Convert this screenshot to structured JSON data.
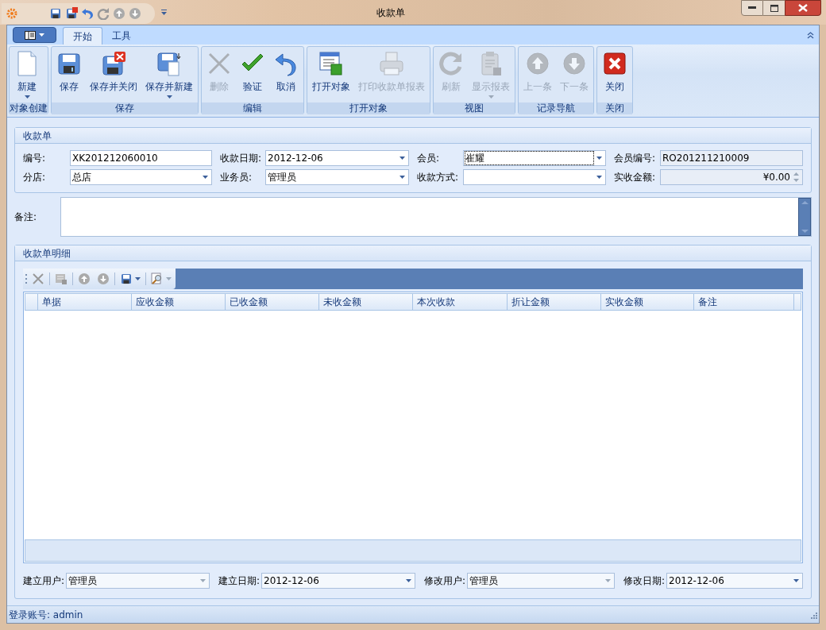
{
  "window": {
    "title": "收款单"
  },
  "ribbon": {
    "tabs": [
      {
        "label": "开始",
        "selected": true
      },
      {
        "label": "工具",
        "selected": false
      }
    ],
    "groups": [
      {
        "label": "对象创建",
        "buttons": [
          {
            "label": "新建",
            "disabled": false,
            "dropdown": true
          }
        ]
      },
      {
        "label": "保存",
        "buttons": [
          {
            "label": "保存",
            "disabled": false,
            "dropdown": false
          },
          {
            "label": "保存并关闭",
            "disabled": false,
            "dropdown": false
          },
          {
            "label": "保存并新建",
            "disabled": false,
            "dropdown": true
          }
        ]
      },
      {
        "label": "编辑",
        "buttons": [
          {
            "label": "删除",
            "disabled": true,
            "dropdown": false
          },
          {
            "label": "验证",
            "disabled": false,
            "dropdown": false
          },
          {
            "label": "取消",
            "disabled": false,
            "dropdown": false
          }
        ]
      },
      {
        "label": "打开对象",
        "buttons": [
          {
            "label": "打开对象",
            "disabled": false,
            "dropdown": false
          },
          {
            "label": "打印收款单报表",
            "disabled": true,
            "dropdown": false
          }
        ]
      },
      {
        "label": "视图",
        "buttons": [
          {
            "label": "刷新",
            "disabled": true,
            "dropdown": false
          },
          {
            "label": "显示报表",
            "disabled": true,
            "dropdown": true
          }
        ]
      },
      {
        "label": "记录导航",
        "buttons": [
          {
            "label": "上一条",
            "disabled": true,
            "dropdown": false
          },
          {
            "label": "下一条",
            "disabled": true,
            "dropdown": false
          }
        ]
      },
      {
        "label": "关闭",
        "buttons": [
          {
            "label": "关闭",
            "disabled": false,
            "dropdown": false
          }
        ]
      }
    ]
  },
  "form": {
    "title": "收款单",
    "fields": [
      {
        "label": "编号:",
        "value": "XK201212060010",
        "kind": "text",
        "readonly": false,
        "focused": false
      },
      {
        "label": "收款日期:",
        "value": "2012-12-06",
        "kind": "combo",
        "readonly": false,
        "focused": false
      },
      {
        "label": "会员:",
        "value": "崔耀",
        "kind": "combo",
        "readonly": false,
        "focused": true
      },
      {
        "label": "会员编号:",
        "value": "RO201211210009",
        "kind": "text",
        "readonly": true,
        "focused": false
      },
      {
        "label": "分店:",
        "value": "总店",
        "kind": "combo",
        "readonly": false,
        "focused": false
      },
      {
        "label": "业务员:",
        "value": "管理员",
        "kind": "combo",
        "readonly": false,
        "focused": false
      },
      {
        "label": "收款方式:",
        "kind": "combo",
        "readonly": false,
        "focused": false
      },
      {
        "label": "实收金额:",
        "value": "¥0.00",
        "kind": "spin",
        "readonly": true,
        "focused": false
      }
    ],
    "remark_label": "备注:"
  },
  "detail": {
    "title": "收款单明细",
    "columns": [
      "单据",
      "应收金额",
      "已收金额",
      "未收金额",
      "本次收款",
      "折让金额",
      "实收金额",
      "备注"
    ]
  },
  "footer_fields": [
    {
      "label": "建立用户:",
      "value": "管理员",
      "disabled": true
    },
    {
      "label": "建立日期:",
      "value": "2012-12-06",
      "disabled": false
    },
    {
      "label": "修改用户:",
      "value": "管理员",
      "disabled": true
    },
    {
      "label": "修改日期:",
      "value": "2012-12-06",
      "disabled": false
    }
  ],
  "status_bar": {
    "text": "登录账号: admin"
  }
}
